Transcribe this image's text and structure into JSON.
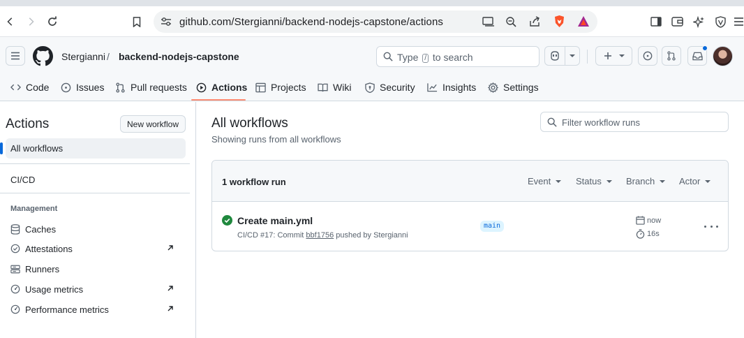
{
  "browser": {
    "url": "github.com/Stergianni/backend-nodejs-capstone/actions"
  },
  "header": {
    "owner": "Stergianni",
    "separator": "/",
    "repo": "backend-nodejs-capstone",
    "search_prefix": "Type",
    "search_key": "/",
    "search_suffix": "to search"
  },
  "repo_nav": {
    "items": [
      {
        "label": "Code",
        "icon": "code-icon"
      },
      {
        "label": "Issues",
        "icon": "issue-opened-icon"
      },
      {
        "label": "Pull requests",
        "icon": "git-pull-request-icon"
      },
      {
        "label": "Actions",
        "icon": "play-icon",
        "active": true
      },
      {
        "label": "Projects",
        "icon": "table-icon"
      },
      {
        "label": "Wiki",
        "icon": "book-icon"
      },
      {
        "label": "Security",
        "icon": "shield-icon"
      },
      {
        "label": "Insights",
        "icon": "graph-icon"
      },
      {
        "label": "Settings",
        "icon": "gear-icon"
      }
    ]
  },
  "sidebar": {
    "title": "Actions",
    "new_workflow": "New workflow",
    "all_workflows": "All workflows",
    "workflows": [
      "CI/CD"
    ],
    "management_heading": "Management",
    "management": [
      {
        "label": "Caches",
        "icon": "database-icon",
        "external": false
      },
      {
        "label": "Attestations",
        "icon": "verified-icon",
        "external": true
      },
      {
        "label": "Runners",
        "icon": "server-icon",
        "external": false
      },
      {
        "label": "Usage metrics",
        "icon": "meter-icon",
        "external": true
      },
      {
        "label": "Performance metrics",
        "icon": "meter-icon",
        "external": true
      }
    ]
  },
  "main": {
    "title": "All workflows",
    "subtitle": "Showing runs from all workflows",
    "filter_placeholder": "Filter workflow runs",
    "runs_count": "1 workflow run",
    "filters": [
      "Event",
      "Status",
      "Branch",
      "Actor"
    ],
    "run": {
      "title": "Create main.yml",
      "meta_prefix": "CI/CD #17: Commit",
      "sha": "bbf1756",
      "meta_suffix": "pushed by Stergianni",
      "branch": "main",
      "time": "now",
      "duration": "16s",
      "status": "success"
    }
  },
  "colors": {
    "accent": "#0969da",
    "success": "#1f883d",
    "nav_underline": "#fd8c73"
  }
}
